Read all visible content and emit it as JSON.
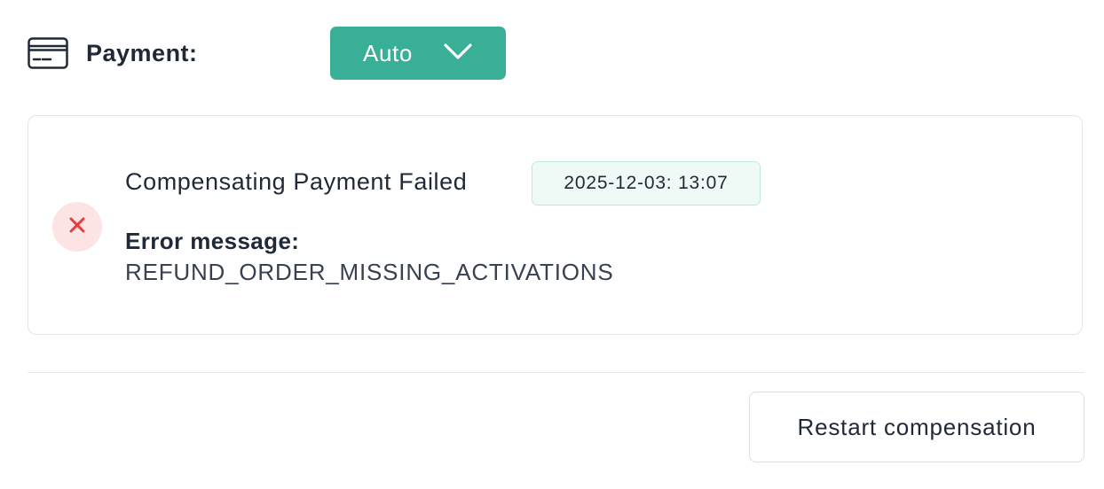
{
  "payment": {
    "label": "Payment:",
    "icon": "credit-card-icon",
    "mode_value": "Auto",
    "dropdown_color": "#3aaf98"
  },
  "event": {
    "status": "failed",
    "status_icon": "close-icon",
    "title": "Compensating Payment Failed",
    "timestamp": "2025-12-03: 13:07",
    "error_label": "Error message:",
    "error_message": "REFUND_ORDER_MISSING_ACTIVATIONS"
  },
  "actions": {
    "restart_label": "Restart compensation"
  },
  "colors": {
    "accent": "#3aaf98",
    "error": "#e53e3e",
    "error_bg": "#fde4e4",
    "timestamp_bg": "#edfaf6"
  }
}
